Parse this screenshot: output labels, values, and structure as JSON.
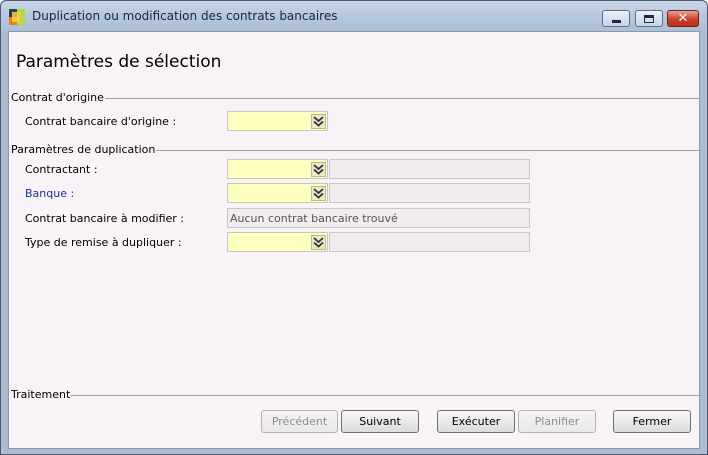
{
  "window": {
    "title": "Duplication ou modification des contrats bancaires",
    "close_glyph": "✕"
  },
  "page": {
    "title": "Paramètres de sélection"
  },
  "groups": {
    "origin": {
      "label": "Contrat d'origine",
      "fields": [
        {
          "label": "Contrat bancaire d'origine :",
          "value": ""
        }
      ]
    },
    "duplication": {
      "label": "Paramètres de duplication",
      "fields": [
        {
          "label": "Contractant :",
          "value": "",
          "description": ""
        },
        {
          "label": "Banque :",
          "value": "",
          "description": ""
        },
        {
          "label": "Contrat bancaire à modifier :",
          "value": "Aucun contrat bancaire trouvé"
        },
        {
          "label": "Type de remise à dupliquer :",
          "value": "",
          "description": ""
        }
      ]
    },
    "treatment": {
      "label": "Traitement"
    }
  },
  "buttons": {
    "previous": "Précédent",
    "next": "Suivant",
    "execute": "Exécuter",
    "schedule": "Planifier",
    "close": "Fermer"
  },
  "colors": {
    "required_field": "#ffffc0",
    "client_bg": "#f7f3f7",
    "label_link": "#1a2f8a"
  },
  "icons": {
    "dropdown": "double-chevron-down-icon",
    "minimize": "minimize-icon",
    "maximize": "maximize-icon",
    "close": "close-icon"
  }
}
